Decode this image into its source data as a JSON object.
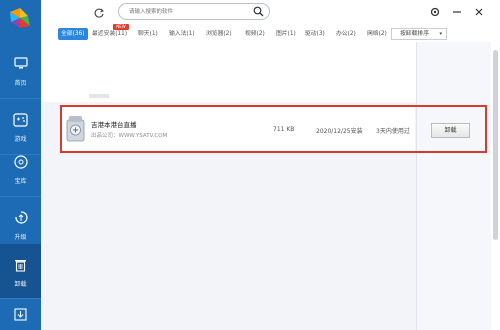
{
  "sidebar": {
    "logo": "app-logo-icon",
    "items": [
      {
        "label": "首页",
        "icon": "monitor-icon"
      },
      {
        "label": "游戏",
        "icon": "gamepad-icon"
      },
      {
        "label": "宝库",
        "icon": "disc-icon"
      },
      {
        "label": "升级",
        "icon": "upgrade-icon"
      },
      {
        "label": "卸载",
        "icon": "trash-icon"
      },
      {
        "label": "",
        "icon": "download-icon"
      }
    ],
    "active_index": 4
  },
  "search": {
    "placeholder": "请输入搜索的软件"
  },
  "tabs": [
    {
      "label": "全部(36)",
      "active": true
    },
    {
      "label": "最近安装(11)"
    },
    {
      "label": "聊天(1)"
    },
    {
      "label": "输入法(1)"
    },
    {
      "label": "浏览器(2)"
    },
    {
      "label": "视频(2)"
    },
    {
      "label": "图片(1)"
    },
    {
      "label": "驱动(3)"
    },
    {
      "label": "办公(2)"
    },
    {
      "label": "网络(2)"
    }
  ],
  "new_badge": "NEW",
  "tab_scroll_arrow": "›",
  "sort": {
    "label": "按卸载排序"
  },
  "app": {
    "name": "吉港本港台直播",
    "publisher": "出品公司：WWW.YSATV.COM",
    "size": "711 KB",
    "install_date": "2020/12/25安装",
    "usage": "3天内使用过",
    "uninstall_label": "卸载"
  },
  "colors": {
    "sidebar": "#1d6bb5",
    "sidebar_active": "#165392",
    "tab_active": "#2d86dd",
    "highlight": "#d93a2f",
    "badge": "#e23c30"
  }
}
